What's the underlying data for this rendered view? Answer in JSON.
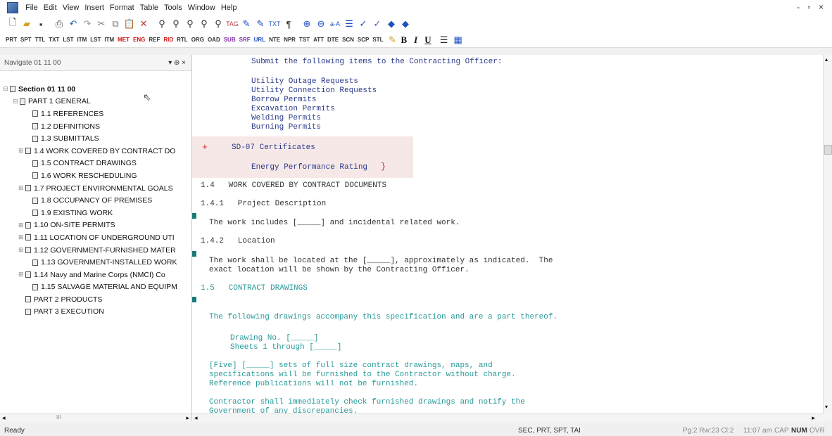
{
  "menubar": {
    "items": [
      "File",
      "Edit",
      "View",
      "Insert",
      "Format",
      "Table",
      "Tools",
      "Window",
      "Help"
    ],
    "window_controls": "- ▫ ×"
  },
  "toolbar1": {
    "icons": [
      "new-icon",
      "open-icon",
      "save-icon",
      "print-icon",
      "undo-icon",
      "redo-icon",
      "cut-icon",
      "copy-icon",
      "paste-icon",
      "delete-icon",
      "find-icon",
      "find-next-icon",
      "find-tag-icon",
      "replace-icon",
      "replace-all-icon",
      "tag-icon",
      "spell-icon",
      "format-icon",
      "tag-view-icon",
      "paragraph-icon",
      "zoom-in-icon",
      "zoom-out-icon",
      "font-size-icon",
      "list-icon",
      "check-icon",
      "validate-icon",
      "prev-icon",
      "next-icon"
    ]
  },
  "toolbar2": {
    "tags": [
      "PRT",
      "SPT",
      "TTL",
      "TXT",
      "LST",
      "ITM",
      "LST",
      "ITM",
      "MET",
      "ENG",
      "REF",
      "RID",
      "RTL",
      "ORG",
      "OAD",
      "SUB",
      "SRF",
      "URL",
      "NTE",
      "NPR",
      "TST",
      "ATT",
      "DTE",
      "SCN",
      "SCP",
      "STL"
    ],
    "format_buttons": [
      "B",
      "I",
      "U"
    ]
  },
  "navigator": {
    "title": "Navigate 01 11 00",
    "header_controls": "▾ ⊕ ×",
    "items": [
      {
        "label": "Section 01 11 00",
        "bold": true,
        "indent": 0,
        "exp": "⊟"
      },
      {
        "label": "PART 1  GENERAL",
        "bold": false,
        "indent": 14,
        "exp": "⊟"
      },
      {
        "label": "1.1  REFERENCES",
        "bold": false,
        "indent": 32,
        "exp": ""
      },
      {
        "label": "1.2  DEFINITIONS",
        "bold": false,
        "indent": 32,
        "exp": ""
      },
      {
        "label": "1.3  SUBMITTALS",
        "bold": false,
        "indent": 32,
        "exp": ""
      },
      {
        "label": "1.4  WORK COVERED BY CONTRACT DO",
        "bold": false,
        "indent": 22,
        "exp": "⊞"
      },
      {
        "label": "1.5  CONTRACT DRAWINGS",
        "bold": false,
        "indent": 32,
        "exp": ""
      },
      {
        "label": "1.6  WORK RESCHEDULING",
        "bold": false,
        "indent": 32,
        "exp": ""
      },
      {
        "label": "1.7  PROJECT ENVIRONMENTAL GOALS",
        "bold": false,
        "indent": 22,
        "exp": "⊞"
      },
      {
        "label": "1.8  OCCUPANCY OF PREMISES",
        "bold": false,
        "indent": 32,
        "exp": ""
      },
      {
        "label": "1.9  EXISTING WORK",
        "bold": false,
        "indent": 32,
        "exp": ""
      },
      {
        "label": "1.10  ON-SITE PERMITS",
        "bold": false,
        "indent": 22,
        "exp": "⊞"
      },
      {
        "label": "1.11  LOCATION OF UNDERGROUND UTI",
        "bold": false,
        "indent": 22,
        "exp": "⊞"
      },
      {
        "label": "1.12  GOVERNMENT-FURNISHED MATER",
        "bold": false,
        "indent": 22,
        "exp": "⊞"
      },
      {
        "label": "1.13  GOVERNMENT-INSTALLED WORK",
        "bold": false,
        "indent": 32,
        "exp": ""
      },
      {
        "label": "1.14  Navy and Marine Corps (NMCI) Co",
        "bold": false,
        "indent": 22,
        "exp": "⊞"
      },
      {
        "label": "1.15  SALVAGE MATERIAL AND EQUIPM",
        "bold": false,
        "indent": 32,
        "exp": ""
      },
      {
        "label": "PART 2  PRODUCTS",
        "bold": false,
        "indent": 22,
        "exp": ""
      },
      {
        "label": "PART 3  EXECUTION",
        "bold": false,
        "indent": 22,
        "exp": ""
      }
    ]
  },
  "editor": {
    "lines": [
      {
        "text": "Submit the following items to the Contracting Officer:",
        "cls": ""
      },
      {
        "text": "Utility Outage Requests",
        "cls": ""
      },
      {
        "text": "Utility Connection Requests",
        "cls": ""
      },
      {
        "text": "Borrow Permits",
        "cls": ""
      },
      {
        "text": "Excavation Permits",
        "cls": ""
      },
      {
        "text": "Welding Permits",
        "cls": ""
      },
      {
        "text": "Burning Permits",
        "cls": ""
      },
      {
        "text": "SD-07 Certificates",
        "cls": ""
      },
      {
        "text": "Energy Performance Rating",
        "cls": ""
      },
      {
        "text": "1.4   WORK COVERED BY CONTRACT DOCUMENTS",
        "cls": "plain"
      },
      {
        "text": "1.4.1   Project Description",
        "cls": "plain"
      },
      {
        "text": "The work includes [_____] and incidental related work.",
        "cls": "plain"
      },
      {
        "text": "1.4.2   Location",
        "cls": "plain"
      },
      {
        "text": "The work shall be located at the [_____], approximately as indicated.  The",
        "cls": "plain"
      },
      {
        "text": "exact location will be shown by the Contracting Officer.",
        "cls": "plain"
      },
      {
        "text": "1.5   CONTRACT DRAWINGS",
        "cls": "teal"
      },
      {
        "text": "The following drawings accompany this specification and are a part thereof.",
        "cls": "teal"
      },
      {
        "text": "Drawing No. [_____]",
        "cls": "teal"
      },
      {
        "text": "Sheets 1 through [_____]",
        "cls": "teal"
      },
      {
        "text": "[Five] [_____] sets of full size contract drawings, maps, and",
        "cls": "teal"
      },
      {
        "text": "specifications will be furnished to the Contractor without charge.",
        "cls": "teal"
      },
      {
        "text": "Reference publications will not be furnished.",
        "cls": "teal"
      },
      {
        "text": "Contractor shall immediately check furnished drawings and notify the",
        "cls": "teal"
      },
      {
        "text": "Government of any discrepancies.",
        "cls": "teal"
      }
    ],
    "insert_marker_start": "+",
    "insert_marker_end": "}"
  },
  "statusbar": {
    "ready": "Ready",
    "tags": "SEC, PRT, SPT, TAI",
    "position": "Pg:2 Rw:23 Cl:2",
    "time": "11:07 am",
    "cap": "CAP",
    "num": "NUM",
    "ovr": "OVR"
  },
  "scrollbar": {
    "h_thumb": "III"
  }
}
